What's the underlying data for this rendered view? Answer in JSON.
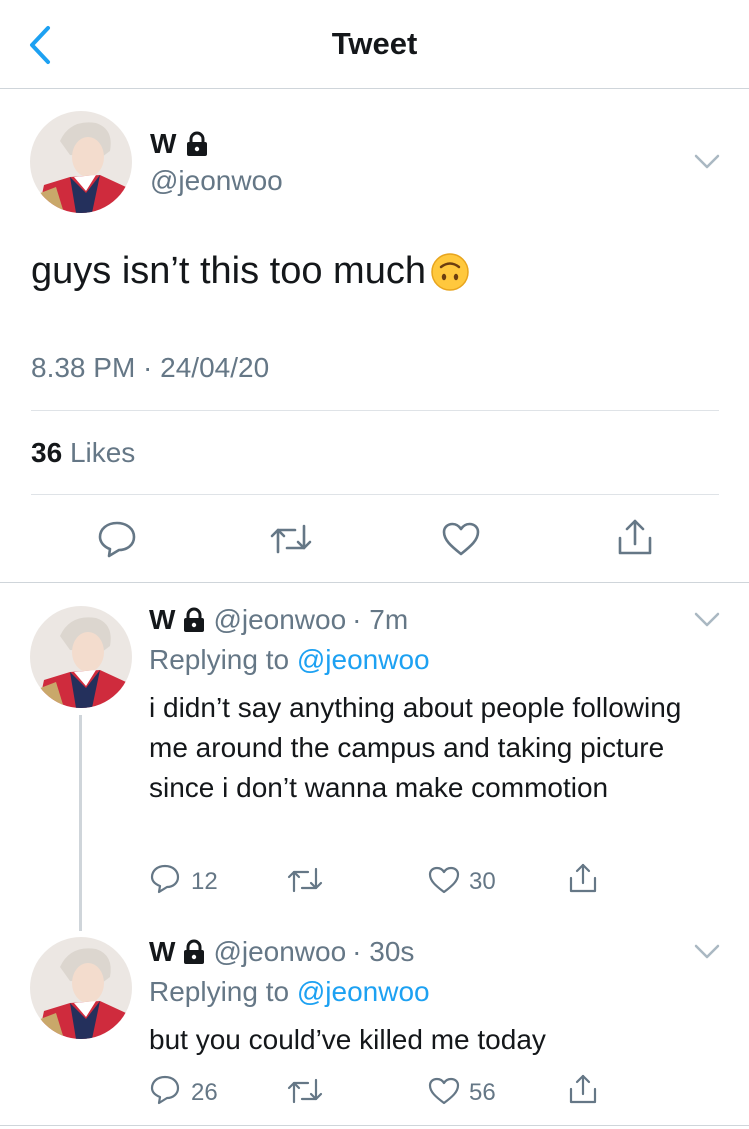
{
  "header": {
    "title": "Tweet"
  },
  "main_tweet": {
    "name": "W",
    "handle": "@jeonwoo",
    "text": "guys isn’t this too much",
    "emoji": "upside-down-face",
    "timestamp": "8.38 PM · 24/04/20",
    "likes_count": "36",
    "likes_label": "Likes"
  },
  "replies": [
    {
      "name": "W",
      "handle": "@jeonwoo",
      "time": "· 7m",
      "replying_prefix": "Replying to",
      "replying_to": "@jeonwoo",
      "text": "i didn’t say anything about people following me around the campus and taking picture since i don’t wanna make commotion",
      "reply_count": "12",
      "like_count": "30"
    },
    {
      "name": "W",
      "handle": "@jeonwoo",
      "time": "· 30s",
      "replying_prefix": "Replying to",
      "replying_to": "@jeonwoo",
      "text": "but you could’ve killed me today",
      "reply_count": "26",
      "like_count": "56"
    }
  ],
  "colors": {
    "accent": "#1da1f2",
    "secondary_text": "#657786",
    "primary_text": "#14171a",
    "divider": "#cfd5da"
  },
  "icons": [
    "back-chevron-icon",
    "lock-icon",
    "chevron-down-icon",
    "reply-icon",
    "retweet-icon",
    "like-icon",
    "share-icon"
  ]
}
